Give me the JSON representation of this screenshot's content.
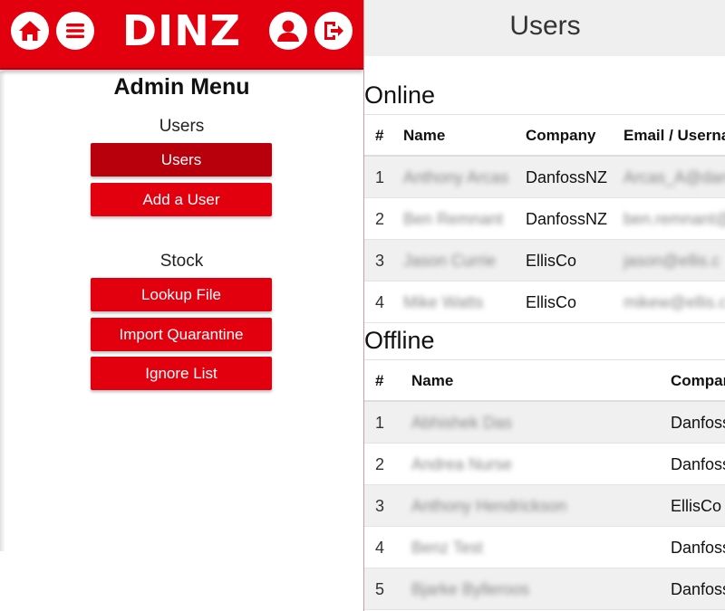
{
  "app": {
    "brand": "DINZ"
  },
  "admin_menu": {
    "title": "Admin Menu",
    "users_section": {
      "label": "Users",
      "buttons": [
        "Users",
        "Add a User"
      ],
      "active": "Users"
    },
    "stock_section": {
      "label": "Stock",
      "buttons": [
        "Lookup File",
        "Import Quarantine",
        "Ignore List"
      ]
    }
  },
  "icons": [
    "home-icon",
    "menu-icon",
    "user-icon",
    "logout-icon"
  ],
  "colors": {
    "brand_red": "#e2000f",
    "active_red": "#b8000c"
  },
  "page": {
    "title": "Users"
  },
  "online": {
    "heading": "Online",
    "columns": [
      "#",
      "Name",
      "Company",
      "Email / Userna"
    ],
    "rows": [
      [
        "1",
        "Anthony Arcas",
        "DanfossNZ",
        "Arcas_A@dan"
      ],
      [
        "2",
        "Ben Remnant",
        "DanfossNZ",
        "ben.remnant@"
      ],
      [
        "3",
        "Jason Currie",
        "EllisCo",
        "jason@ellis.c"
      ],
      [
        "4",
        "Mike Watts",
        "EllisCo",
        "mikew@ellis.c"
      ]
    ]
  },
  "offline": {
    "heading": "Offline",
    "columns": [
      "#",
      "Name",
      "Compar"
    ],
    "rows": [
      [
        "1",
        "Abhishek Das",
        "Danfoss"
      ],
      [
        "2",
        "Andrea Nurse",
        "Danfoss"
      ],
      [
        "3",
        "Anthony Hendrickson",
        "EllisCo"
      ],
      [
        "4",
        "Benz Test",
        "Danfoss"
      ],
      [
        "5",
        "Bjarke Bylleroos",
        "Danfoss"
      ]
    ]
  }
}
